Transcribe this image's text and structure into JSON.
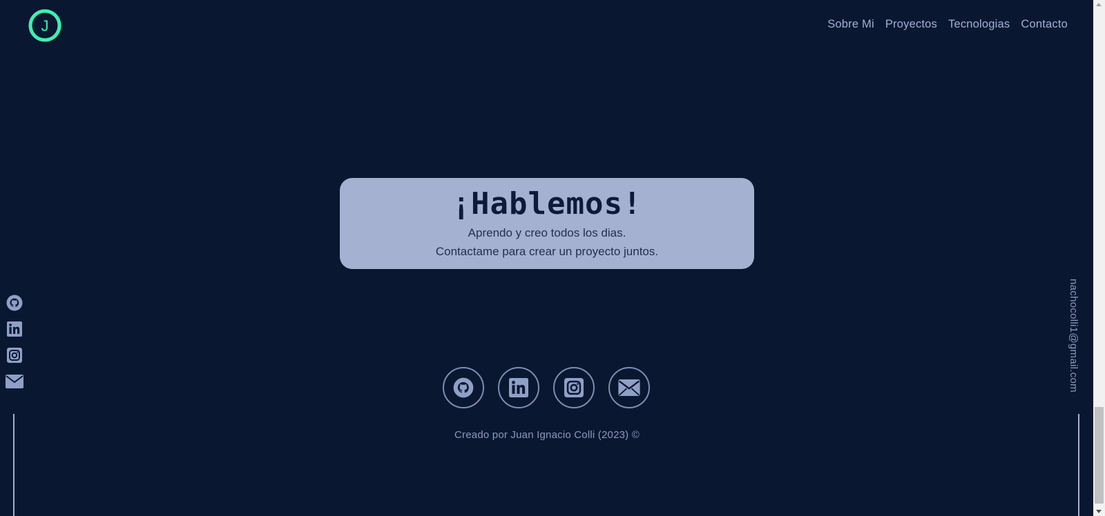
{
  "logo": {
    "letter": "J",
    "accent_color": "#3ef0b0"
  },
  "nav": {
    "items": [
      {
        "label": "Sobre Mi"
      },
      {
        "label": "Proyectos"
      },
      {
        "label": "Tecnologias"
      },
      {
        "label": "Contacto"
      }
    ]
  },
  "hero": {
    "title": "¡Hablemos!",
    "line1": "Aprendo y creo todos los dias.",
    "line2": "Contactame para crear un proyecto juntos."
  },
  "side_left": {
    "icons": [
      "github-icon",
      "linkedin-icon",
      "instagram-icon",
      "mail-icon"
    ]
  },
  "side_right": {
    "email": "nachocolli1@gmail.com"
  },
  "footer": {
    "icons": [
      "github-icon",
      "linkedin-icon",
      "instagram-icon",
      "mail-icon"
    ],
    "credits": "Creado por Juan Ignacio Colli (2023) ©"
  },
  "colors": {
    "background": "#0a1730",
    "card": "#a5b1d0",
    "text_muted": "#a2b0d4",
    "accent": "#3ef0b0"
  }
}
